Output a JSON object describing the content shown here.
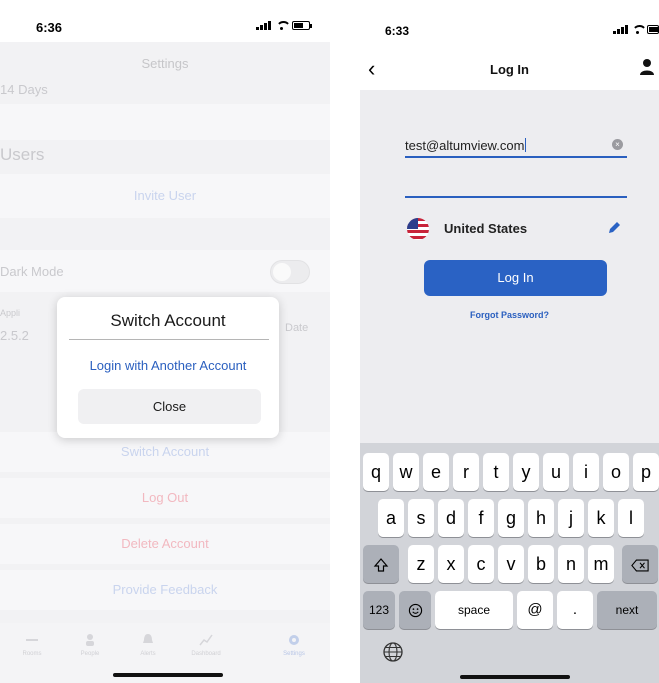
{
  "left": {
    "status_time": "6:36",
    "settings_title": "Settings",
    "retention_value": "14 Days",
    "users_header": "Users",
    "invite_user": "Invite User",
    "dark_mode": "Dark Mode",
    "app_label": "Appli",
    "version": "2.5.2",
    "date_label": "Date",
    "switch_account": "Switch Account",
    "log_out": "Log Out",
    "delete_account": "Delete Account",
    "provide_feedback": "Provide Feedback",
    "tabs": [
      "Rooms",
      "People",
      "Alerts",
      "Dashboard",
      "Settings"
    ],
    "modal": {
      "title": "Switch Account",
      "login_another": "Login with Another Account",
      "close": "Close"
    }
  },
  "right": {
    "status_time": "6:33",
    "nav_title": "Log In",
    "email_value": "test@altumview.com",
    "country": "United States",
    "login_button": "Log In",
    "forgot_password": "Forgot Password?",
    "keyboard": {
      "row1": [
        "q",
        "w",
        "e",
        "r",
        "t",
        "y",
        "u",
        "i",
        "o",
        "p"
      ],
      "row2": [
        "a",
        "s",
        "d",
        "f",
        "g",
        "h",
        "j",
        "k",
        "l"
      ],
      "row3": [
        "z",
        "x",
        "c",
        "v",
        "b",
        "n",
        "m"
      ],
      "numbers": "123",
      "space": "space",
      "at": "@",
      "dot": ".",
      "next": "next"
    }
  },
  "colors": {
    "accent": "#2a62c4",
    "link": "#2a5fbf",
    "danger_dim": "#f2b8c0",
    "keyboard_bg": "#d2d4d9"
  }
}
